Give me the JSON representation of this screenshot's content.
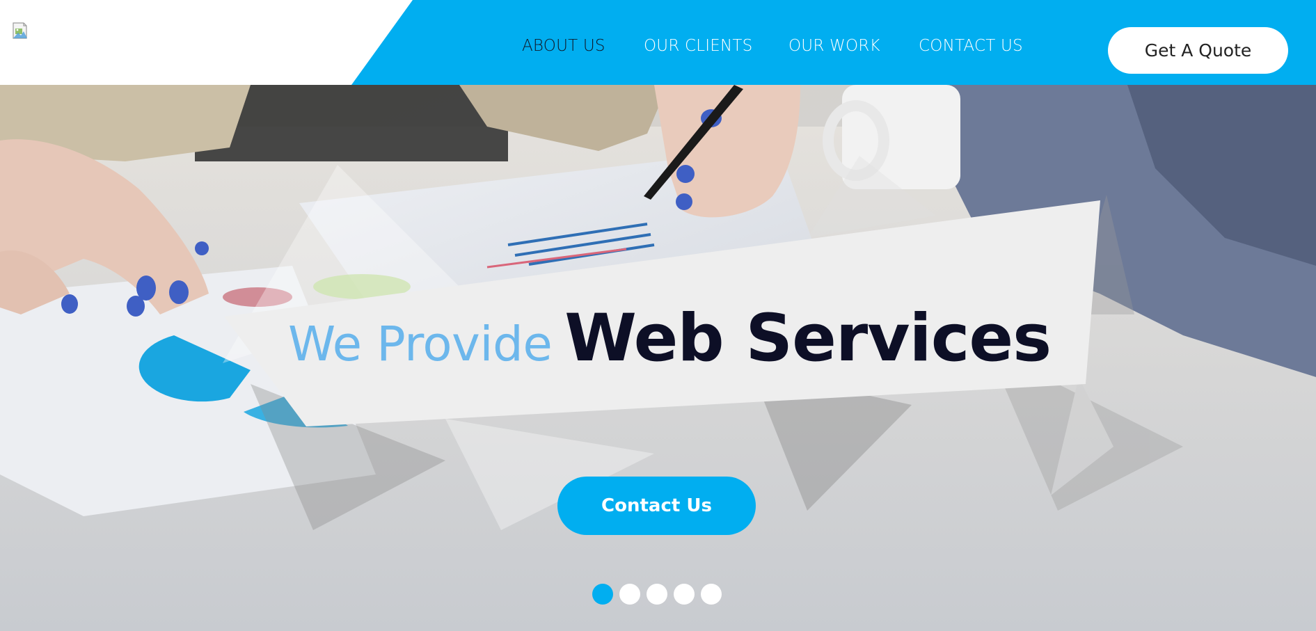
{
  "header": {
    "logo_alt": "",
    "nav": [
      {
        "label": "ABOUT US",
        "active": true
      },
      {
        "label": "OUR CLIENTS",
        "active": false
      },
      {
        "label": "OUR WORK",
        "active": false
      },
      {
        "label": "CONTACT US",
        "active": false
      }
    ],
    "quote_label": "Get A Quote"
  },
  "hero": {
    "headline_light": "We Provide",
    "headline_bold": "Web Services",
    "cta_label": "Contact Us",
    "slides": {
      "count": 5,
      "active": 0
    }
  },
  "colors": {
    "accent": "#01aef0",
    "headline_light": "#6cb7ec",
    "headline_dark": "#0d0f26",
    "nav_active": "#111827"
  }
}
